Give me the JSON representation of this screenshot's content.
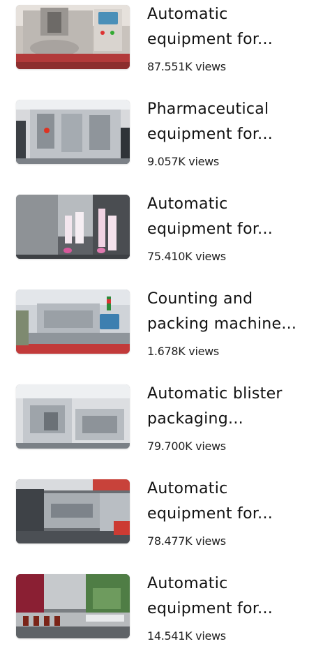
{
  "videos": [
    {
      "title": "Automatic\nequipment for...",
      "views": "87.551K views",
      "thumbnail": "capsule-filling-machine"
    },
    {
      "title": "Pharmaceutical\nequipment for...",
      "views": "9.057K views",
      "thumbnail": "pharmaceutical-machine-exhibition"
    },
    {
      "title": "Automatic\nequipment for...",
      "views": "75.410K views",
      "thumbnail": "tube-filling-machine"
    },
    {
      "title": "Counting and\npacking machine...",
      "views": "1.678K views",
      "thumbnail": "counting-packing-machine"
    },
    {
      "title": "Automatic blister\npackaging...",
      "views": "79.700K views",
      "thumbnail": "blister-packaging-machine"
    },
    {
      "title": "Automatic\nequipment for...",
      "views": "78.477K views",
      "thumbnail": "filling-line-exhibition"
    },
    {
      "title": "Automatic\nequipment for...",
      "views": "14.541K views",
      "thumbnail": "bottle-labeling-machine"
    }
  ]
}
